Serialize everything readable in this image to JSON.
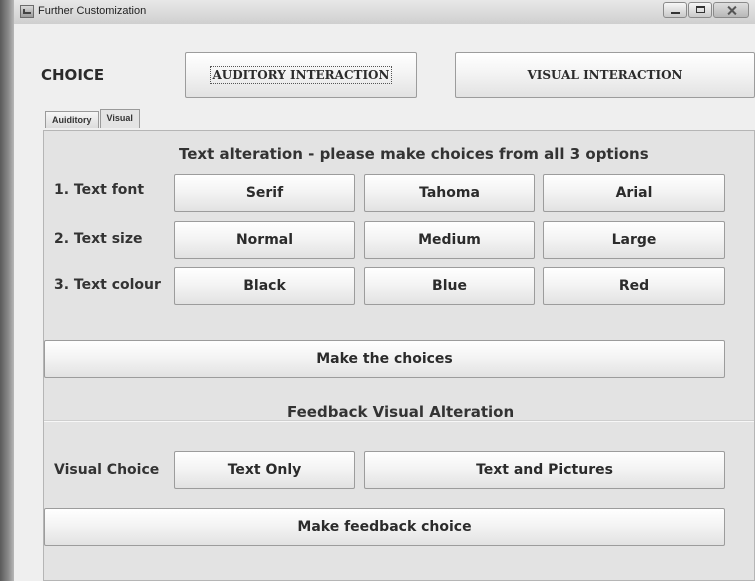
{
  "window": {
    "title": "Further Customization"
  },
  "choice": {
    "label": "CHOICE",
    "auditory_button": "AUDITORY INTERACTION",
    "visual_button": "VISUAL INTERACTION"
  },
  "tabs": [
    {
      "label": "Auiditory"
    },
    {
      "label": "Visual"
    }
  ],
  "text_alteration": {
    "title": "Text alteration - please make choices from all 3 options",
    "rows": [
      {
        "label": "1. Text font",
        "options": [
          "Serif",
          "Tahoma",
          "Arial"
        ]
      },
      {
        "label": "2. Text size",
        "options": [
          "Normal",
          "Medium",
          "Large"
        ]
      },
      {
        "label": "3. Text colour",
        "options": [
          "Black",
          "Blue",
          "Red"
        ]
      }
    ],
    "submit": "Make the choices"
  },
  "feedback": {
    "title": "Feedback Visual Alteration",
    "row_label": "Visual Choice",
    "options": [
      "Text Only",
      "Text and Pictures"
    ],
    "submit": "Make feedback choice"
  },
  "icons": {
    "app": "app-icon",
    "minimize": "minimize-icon",
    "maximize": "maximize-icon",
    "close": "close-icon"
  }
}
